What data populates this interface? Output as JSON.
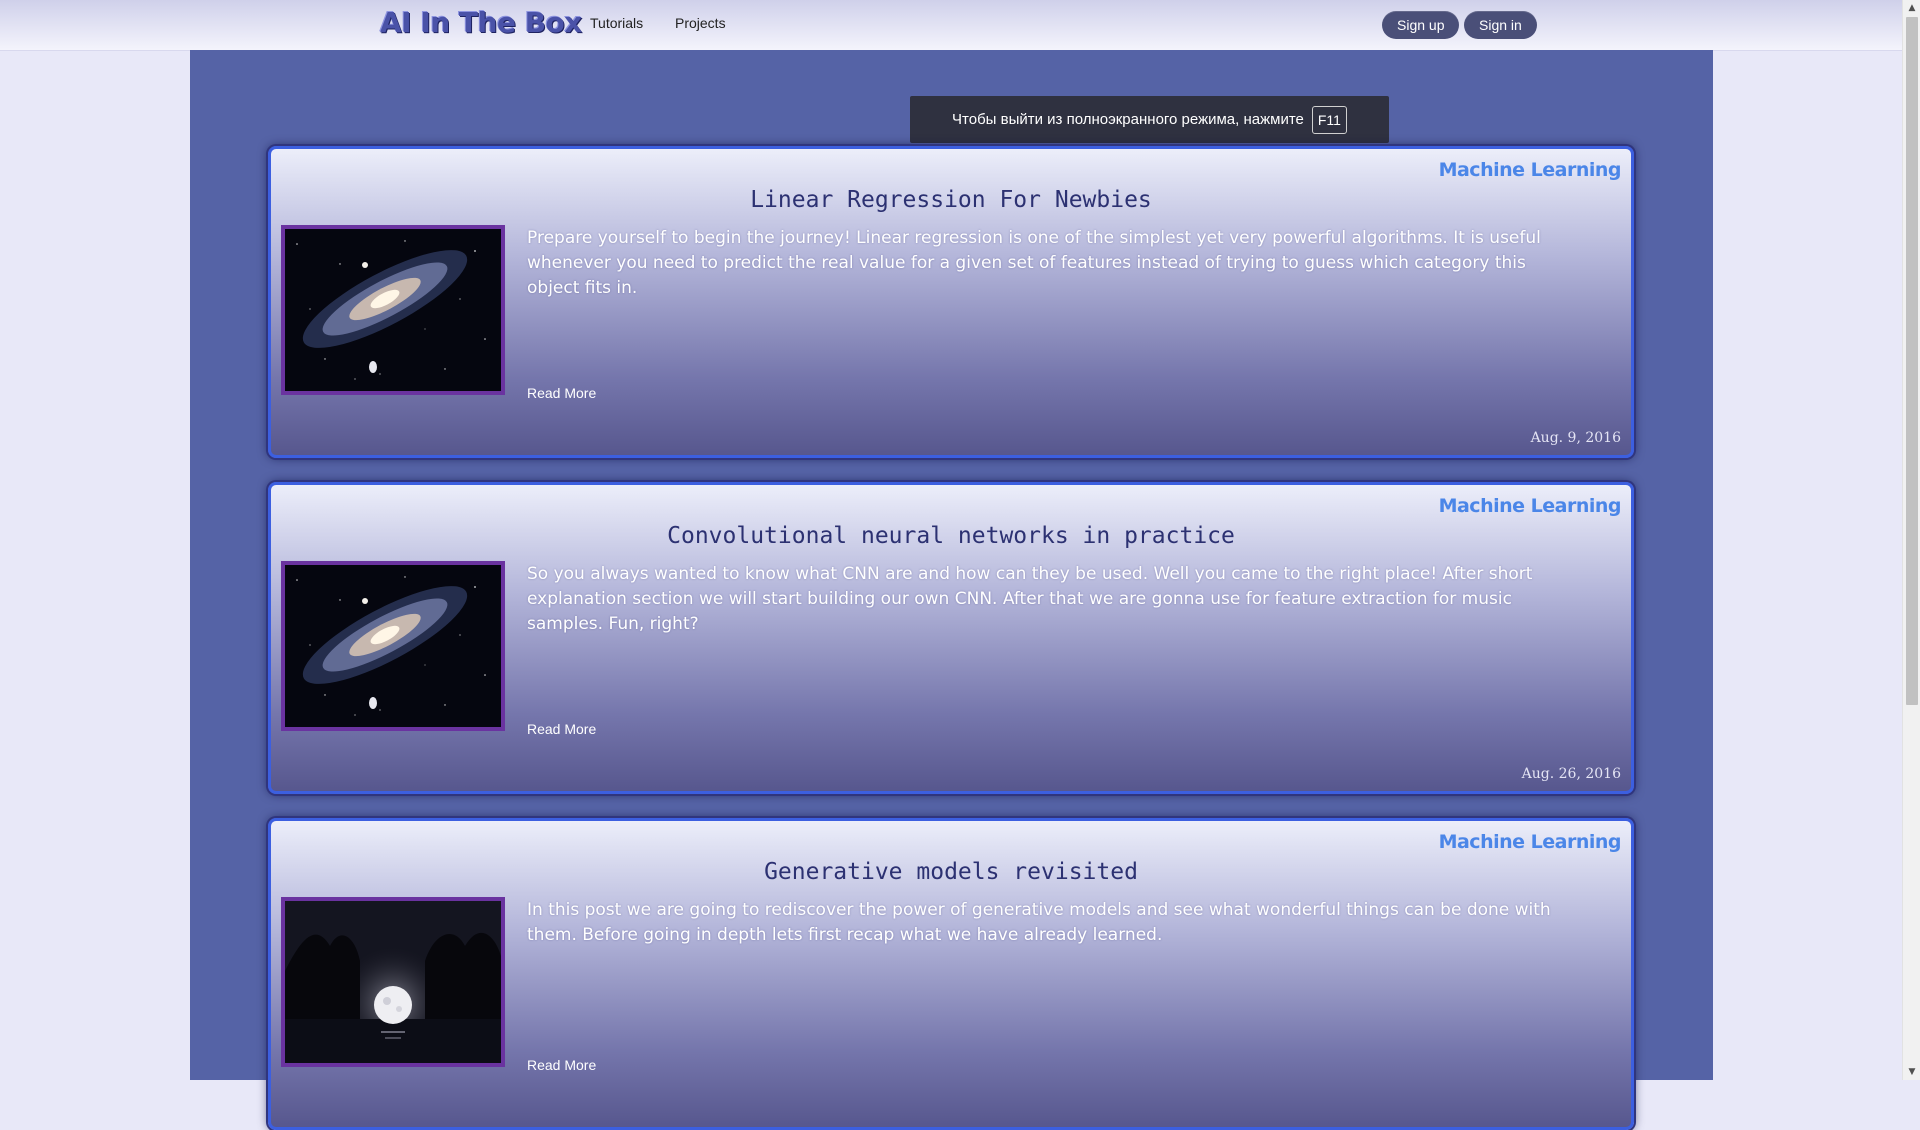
{
  "header": {
    "brand": "AI In The Box",
    "nav": [
      "Tutorials",
      "Projects"
    ],
    "signup_label": "Sign up",
    "signin_label": "Sign in"
  },
  "fullscreen_notice": {
    "text": "Чтобы выйти из полноэкранного режима, нажмите",
    "key": "F11"
  },
  "posts": [
    {
      "category": "Machine Learning",
      "title": "Linear Regression For Newbies",
      "summary": "Prepare yourself to begin the journey! Linear regression is one of the simplest yet very powerful algorithms. It is useful whenever you need to predict the real value for a given set of features instead of trying to guess which category this object fits in.",
      "read_more": "Read More",
      "date": "Aug. 9, 2016",
      "thumbnail": "galaxy-image"
    },
    {
      "category": "Machine Learning",
      "title": "Convolutional neural networks in practice",
      "summary": "So you always wanted to know what CNN are and how can they be used. Well you came to the right place! After short explanation section we will start building our own CNN. After that we are gonna use for feature extraction for music samples. Fun, right?",
      "read_more": "Read More",
      "date": "Aug. 26, 2016",
      "thumbnail": "galaxy-image"
    },
    {
      "category": "Machine Learning",
      "title": "Generative models revisited",
      "summary": "In this post we are going to rediscover the power of generative models and see what wonderful things can be done with them. Before going in depth lets first recap what we have already learned.",
      "read_more": "Read More",
      "date": "",
      "thumbnail": "moon-image"
    }
  ],
  "colors": {
    "page_background": "#e8e8f8",
    "main_background": "#5563a6",
    "category_text": "#4b86e8",
    "title_text": "#2c3172",
    "card_border": "#3c5fe0",
    "thumb_border": "#6a33a0",
    "button_background": "#4a4f78"
  }
}
